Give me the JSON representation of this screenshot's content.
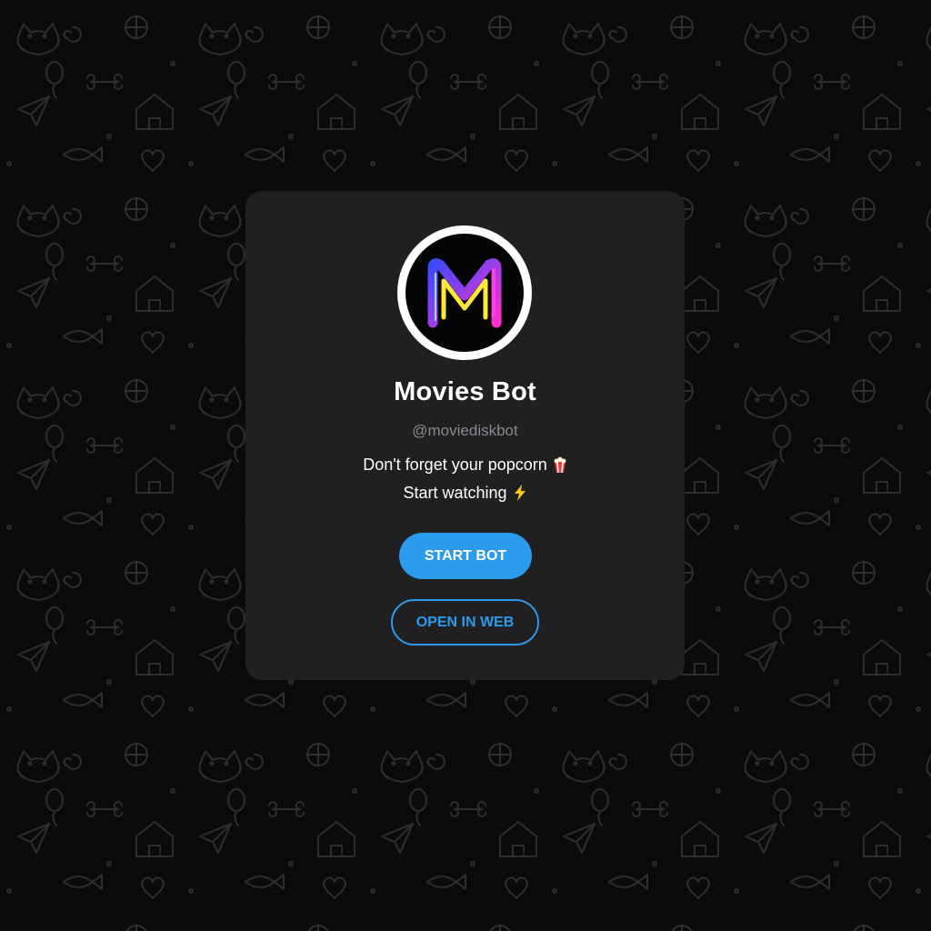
{
  "bot": {
    "name": "Movies Bot",
    "username": "@moviediskbot",
    "description_line1": "Don't forget your popcorn",
    "description_line1_emoji": "popcorn-emoji",
    "description_line2": "Start watching",
    "description_line2_emoji": "lightning-emoji",
    "avatar_letter": "M"
  },
  "actions": {
    "start_label": "START BOT",
    "open_web_label": "OPEN IN WEB"
  },
  "colors": {
    "accent": "#2b9bed",
    "card_background": "#202022",
    "page_background": "#0b0b0b"
  }
}
